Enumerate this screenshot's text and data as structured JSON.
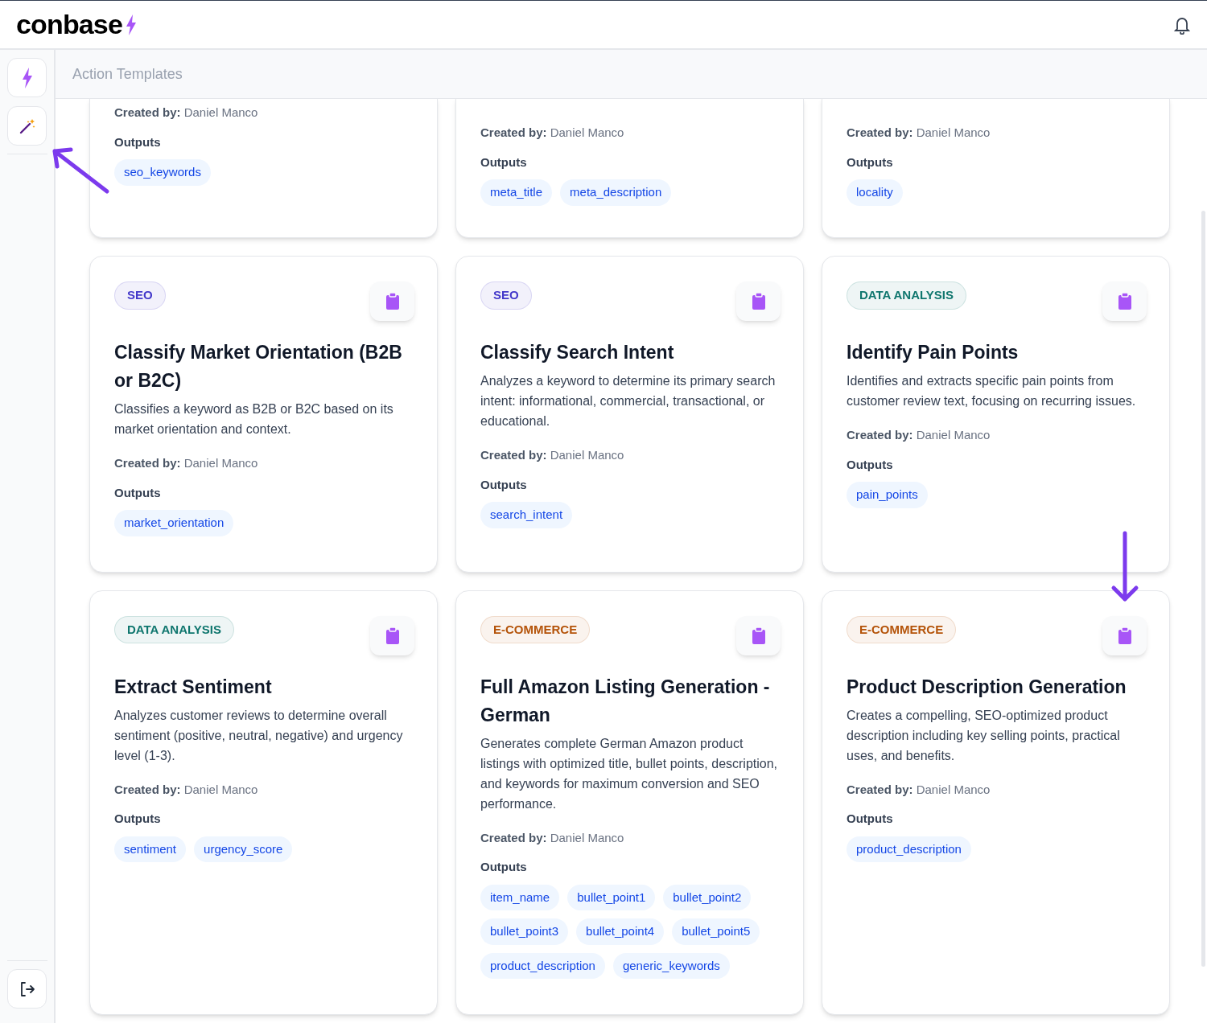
{
  "header": {
    "logo": "conbase"
  },
  "page_title": "Action Templates",
  "cards": [
    {
      "partial": true,
      "created_by_label": "Created by:",
      "author": "Daniel Manco",
      "outputs_label": "Outputs",
      "outputs": [
        "seo_keywords"
      ]
    },
    {
      "partial": true,
      "created_by_label": "Created by:",
      "author": "Daniel Manco",
      "outputs_label": "Outputs",
      "outputs": [
        "meta_title",
        "meta_description"
      ]
    },
    {
      "partial": true,
      "created_by_label": "Created by:",
      "author": "Daniel Manco",
      "outputs_label": "Outputs",
      "outputs": [
        "locality"
      ]
    },
    {
      "partial": false,
      "category": {
        "label": "SEO",
        "color": "#4338ca"
      },
      "title": "Classify Market Orientation (B2B or B2C)",
      "description": "Classifies a keyword as B2B or B2C based on its market orientation and context.",
      "created_by_label": "Created by:",
      "author": "Daniel Manco",
      "outputs_label": "Outputs",
      "outputs": [
        "market_orientation"
      ]
    },
    {
      "partial": false,
      "category": {
        "label": "SEO",
        "color": "#4338ca"
      },
      "title": "Classify Search Intent",
      "description": "Analyzes a keyword to determine its primary search intent: informational, commercial, transactional, or educational.",
      "created_by_label": "Created by:",
      "author": "Daniel Manco",
      "outputs_label": "Outputs",
      "outputs": [
        "search_intent"
      ]
    },
    {
      "partial": false,
      "category": {
        "label": "DATA ANALYSIS",
        "color": "#0f766e"
      },
      "title": "Identify Pain Points",
      "description": "Identifies and extracts specific pain points from customer review text, focusing on recurring issues.",
      "created_by_label": "Created by:",
      "author": "Daniel Manco",
      "outputs_label": "Outputs",
      "outputs": [
        "pain_points"
      ]
    },
    {
      "partial": false,
      "category": {
        "label": "DATA ANALYSIS",
        "color": "#0f766e"
      },
      "title": "Extract Sentiment",
      "description": "Analyzes customer reviews to determine overall sentiment (positive, neutral, negative) and urgency level (1-3).",
      "created_by_label": "Created by:",
      "author": "Daniel Manco",
      "outputs_label": "Outputs",
      "outputs": [
        "sentiment",
        "urgency_score"
      ]
    },
    {
      "partial": false,
      "category": {
        "label": "E-COMMERCE",
        "color": "#b45309"
      },
      "title": "Full Amazon Listing Generation - German",
      "description": "Generates complete German Amazon product listings with optimized title, bullet points, description, and keywords for maximum conversion and SEO performance.",
      "created_by_label": "Created by:",
      "author": "Daniel Manco",
      "outputs_label": "Outputs",
      "outputs": [
        "item_name",
        "bullet_point1",
        "bullet_point2",
        "bullet_point3",
        "bullet_point4",
        "bullet_point5",
        "product_description",
        "generic_keywords"
      ]
    },
    {
      "partial": false,
      "category": {
        "label": "E-COMMERCE",
        "color": "#b45309"
      },
      "title": "Product Description Generation",
      "description": "Creates a compelling, SEO-optimized product description including key selling points, practical uses, and benefits.",
      "created_by_label": "Created by:",
      "author": "Daniel Manco",
      "outputs_label": "Outputs",
      "outputs": [
        "product_description"
      ]
    }
  ]
}
